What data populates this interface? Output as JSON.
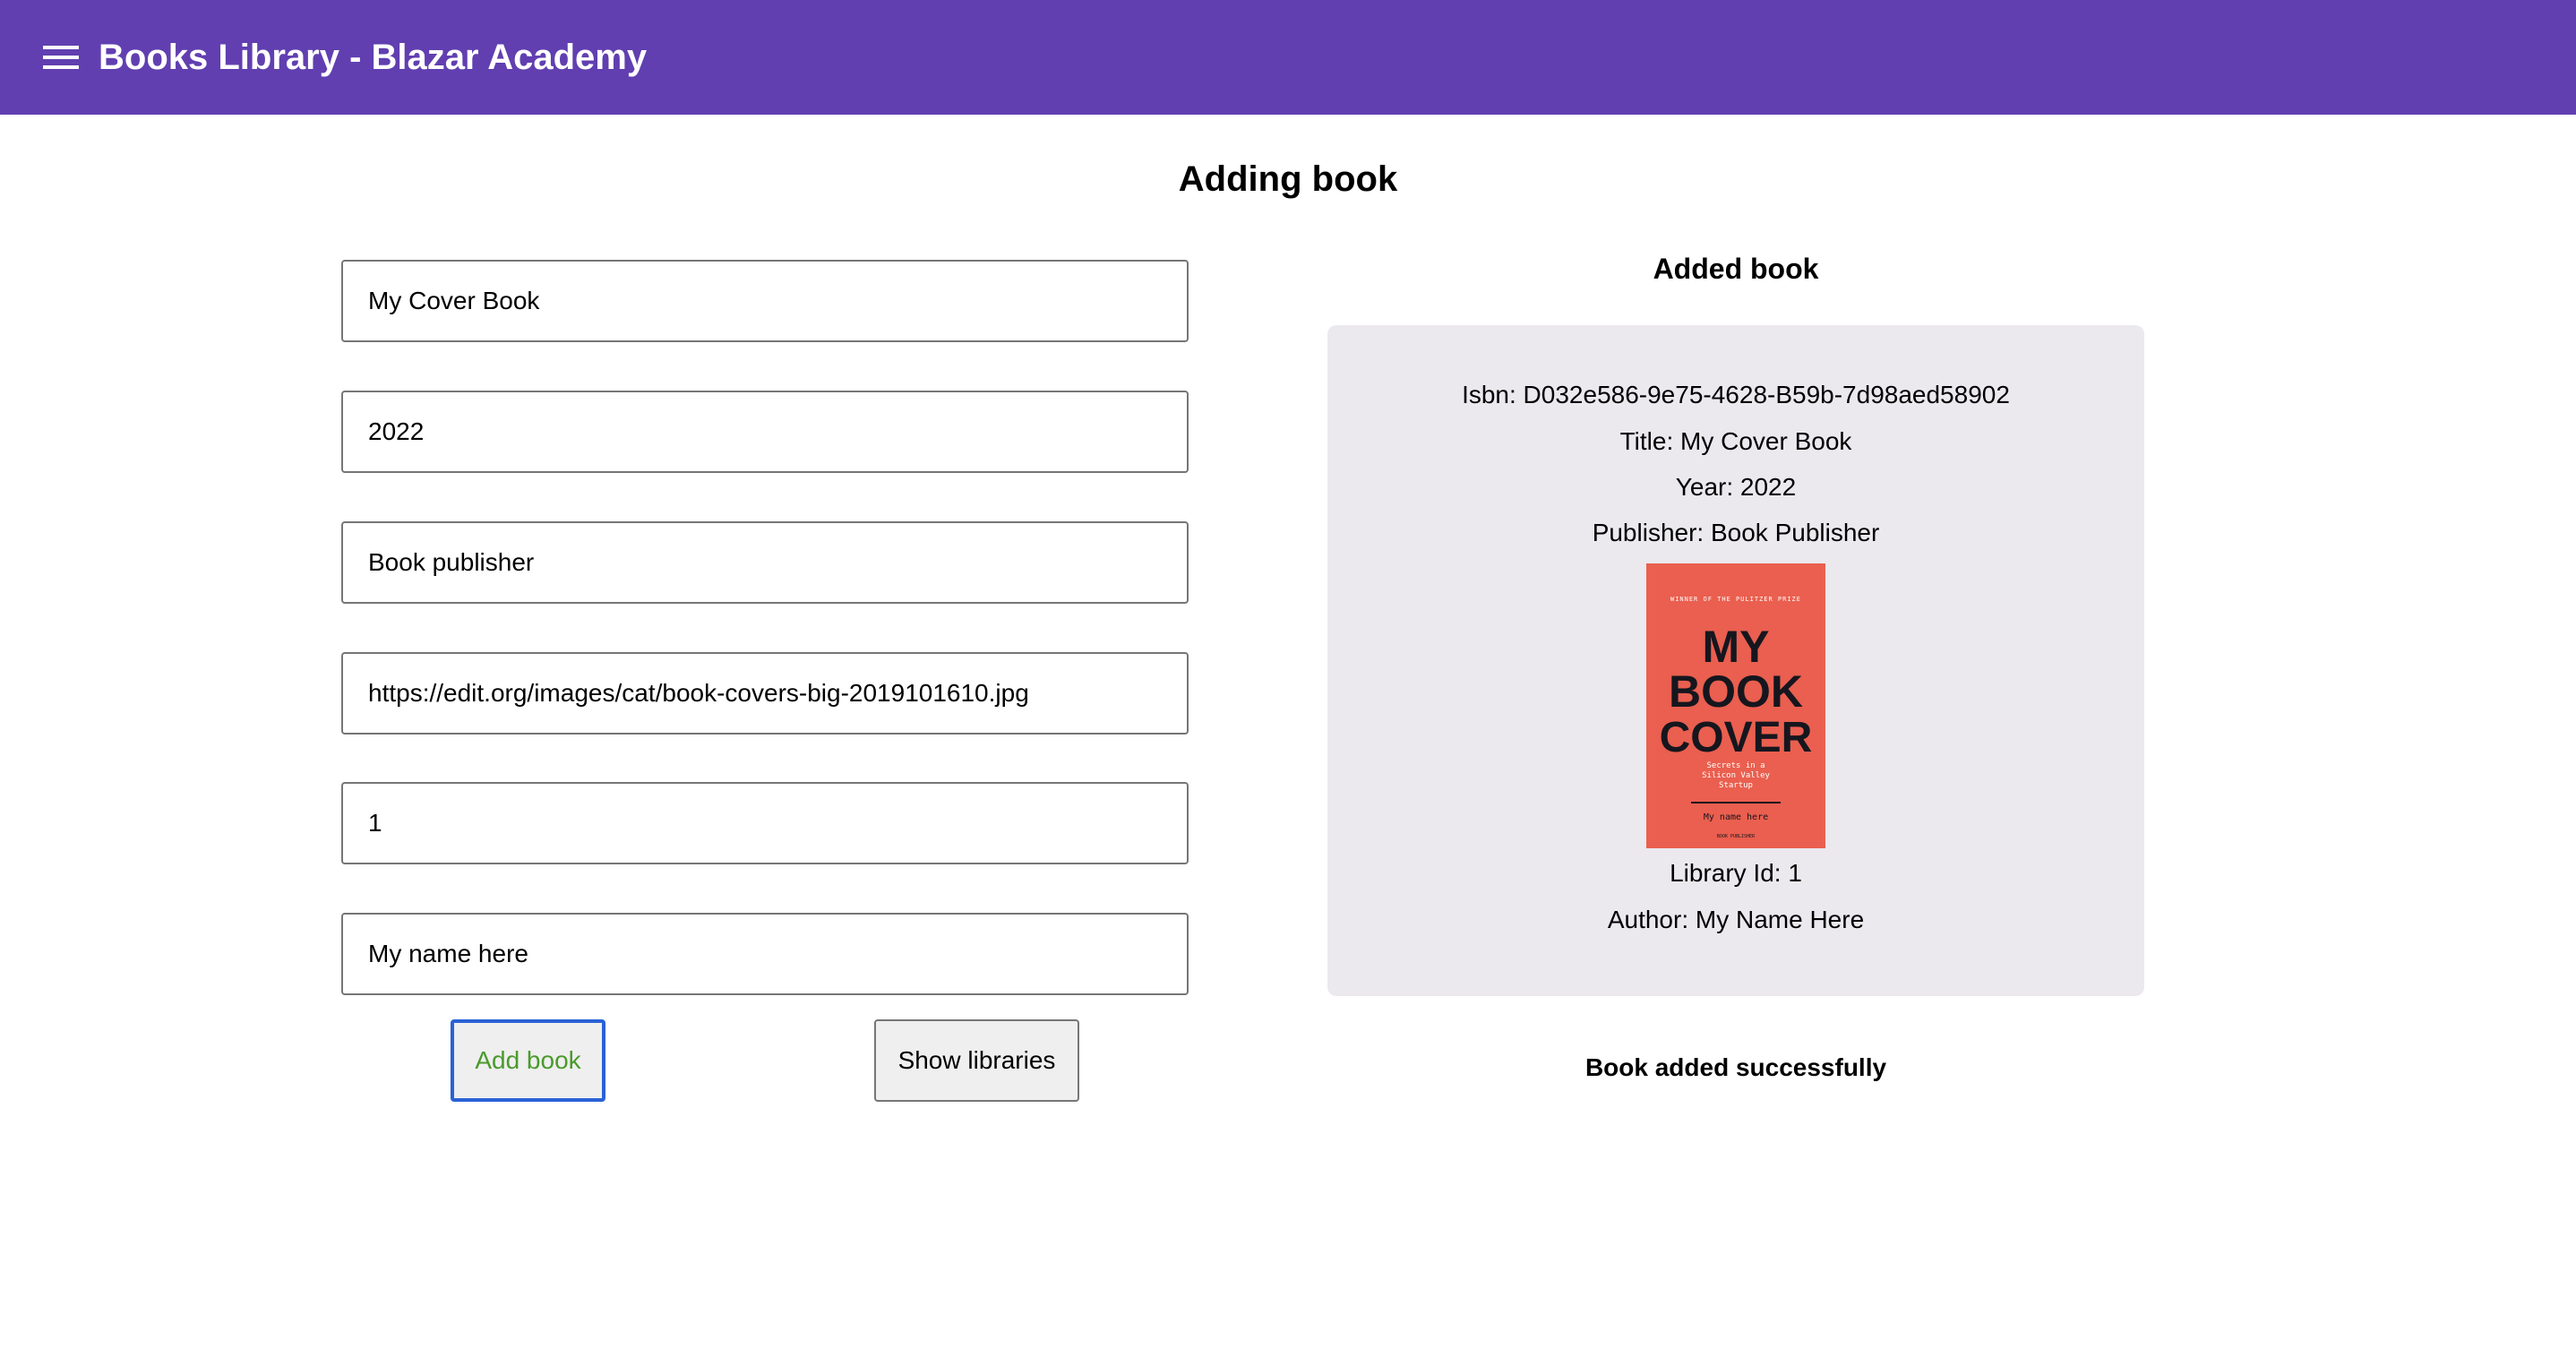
{
  "app": {
    "title": "Books Library - Blazar Academy",
    "menu_icon": "menu-icon",
    "bar_color": "#613fb0"
  },
  "page": {
    "title": "Adding book"
  },
  "form": {
    "fields": [
      {
        "name": "title",
        "value": "My Cover Book"
      },
      {
        "name": "year",
        "value": "2022"
      },
      {
        "name": "publisher",
        "value": "Book publisher"
      },
      {
        "name": "cover_url",
        "value": "https://edit.org/images/cat/book-covers-big-2019101610.jpg"
      },
      {
        "name": "library_id",
        "value": "1"
      },
      {
        "name": "author",
        "value": "My name here"
      }
    ],
    "add_button": "Add book",
    "show_libraries_button": "Show libraries"
  },
  "added": {
    "heading": "Added book",
    "isbn": "Isbn: D032e586-9e75-4628-B59b-7d98aed58902",
    "title": "Title: My Cover Book",
    "year": "Year: 2022",
    "publisher": "Publisher: Book Publisher",
    "library": "Library Id: 1",
    "author": "Author: My Name Here",
    "cover": {
      "top_line": "WINNER OF THE PULITZER PRIZE",
      "title_lines": [
        "MY",
        "BOOK",
        "COVER"
      ],
      "subtitle_lines": [
        "Secrets in a",
        "Silicon Valley",
        "Startup"
      ],
      "author": "My name here",
      "bottom_line": "BOOK PUBLISHER",
      "color": "#ea5f4f"
    },
    "status": "Book added successfully"
  }
}
